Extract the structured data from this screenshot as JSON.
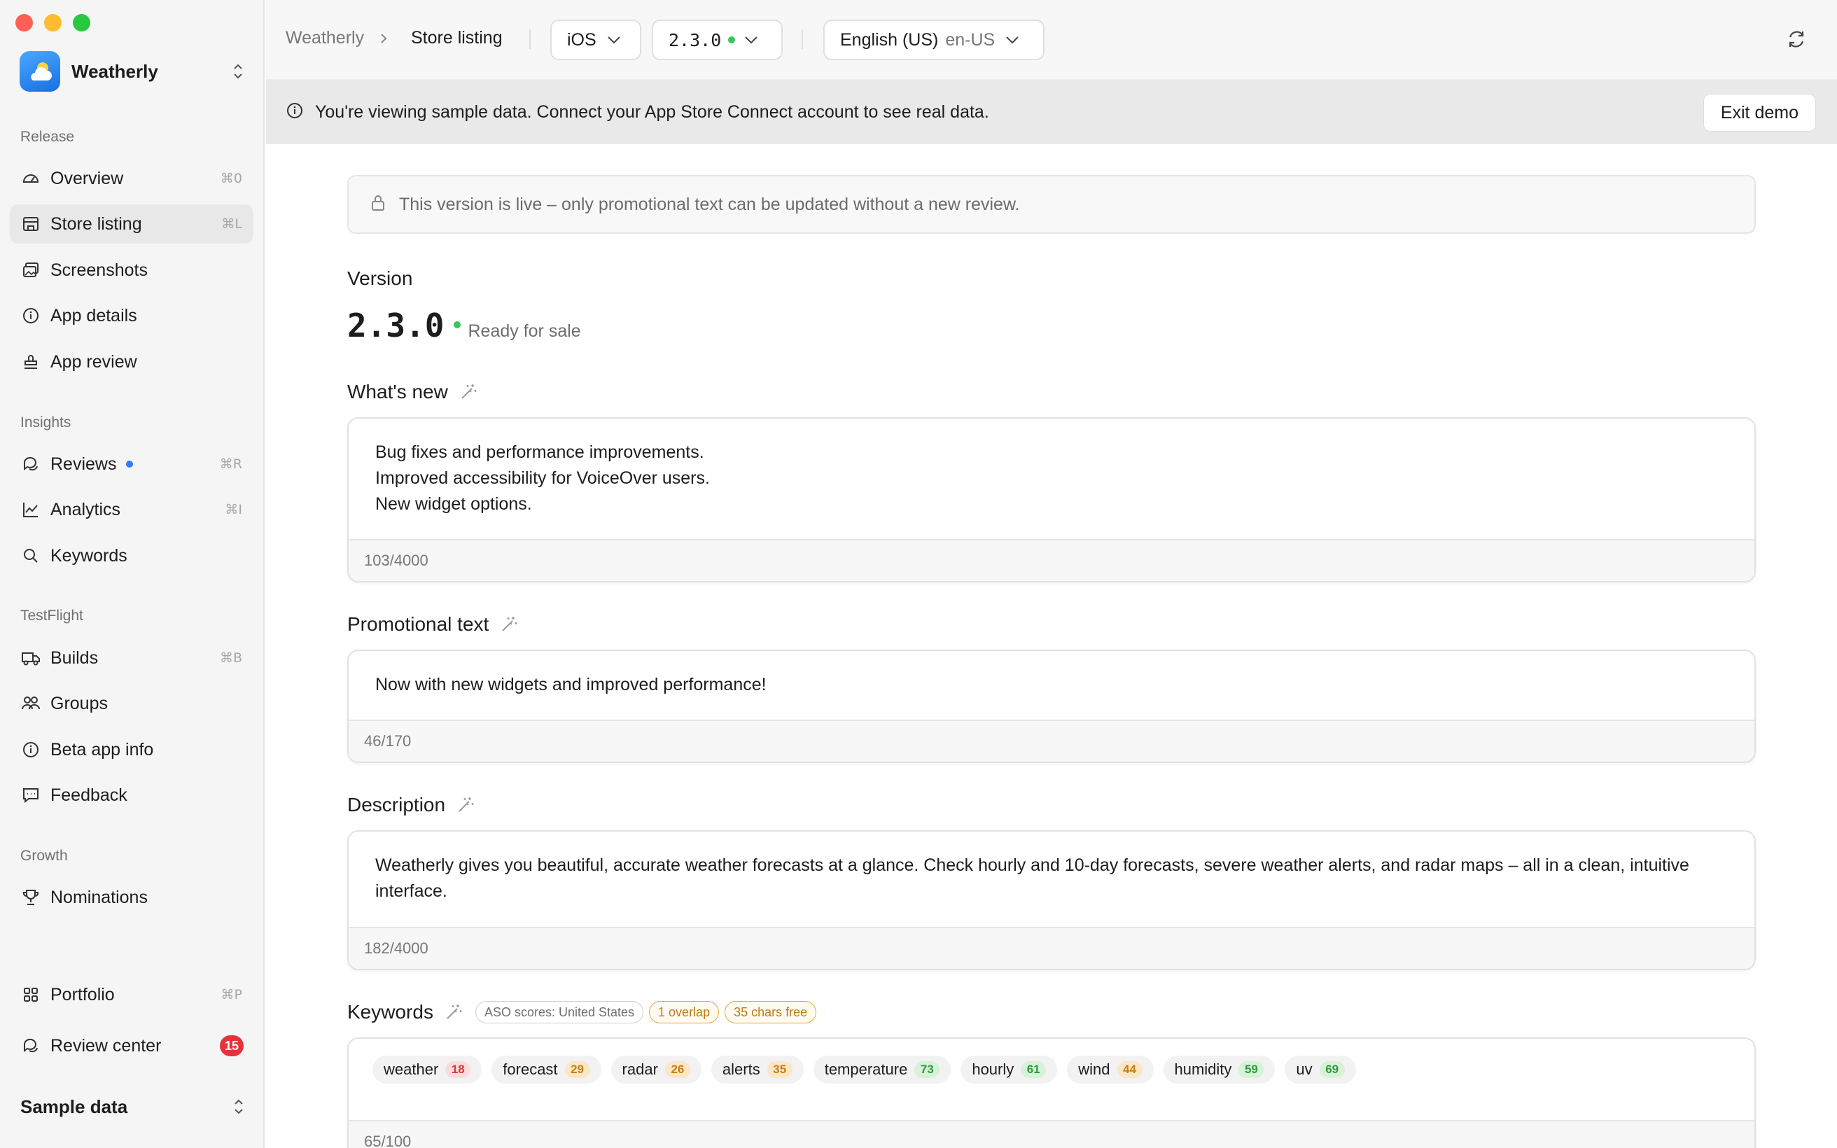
{
  "window": {
    "traffic_colors": [
      "#ff5f57",
      "#febc2e",
      "#28c840"
    ]
  },
  "app": {
    "name": "Weatherly"
  },
  "sidebar": {
    "sections": {
      "release": "Release",
      "insights": "Insights",
      "testflight": "TestFlight",
      "growth": "Growth"
    },
    "items": [
      {
        "label": "Overview",
        "shortcut": "⌘0",
        "icon": "gauge-icon"
      },
      {
        "label": "Store listing",
        "shortcut": "⌘L",
        "icon": "storefront-icon"
      },
      {
        "label": "Screenshots",
        "shortcut": "",
        "icon": "images-icon"
      },
      {
        "label": "App details",
        "shortcut": "",
        "icon": "info-icon"
      },
      {
        "label": "App review",
        "shortcut": "",
        "icon": "stamp-icon"
      },
      {
        "label": "Reviews",
        "shortcut": "⌘R",
        "icon": "chat-icon"
      },
      {
        "label": "Analytics",
        "shortcut": "⌘I",
        "icon": "chart-icon"
      },
      {
        "label": "Keywords",
        "shortcut": "",
        "icon": "search-icon"
      },
      {
        "label": "Builds",
        "shortcut": "⌘B",
        "icon": "truck-icon"
      },
      {
        "label": "Groups",
        "shortcut": "",
        "icon": "users-icon"
      },
      {
        "label": "Beta app info",
        "shortcut": "",
        "icon": "info-icon"
      },
      {
        "label": "Feedback",
        "shortcut": "",
        "icon": "message-icon"
      },
      {
        "label": "Nominations",
        "shortcut": "",
        "icon": "trophy-icon"
      },
      {
        "label": "Portfolio",
        "shortcut": "⌘P",
        "icon": "grid-icon"
      },
      {
        "label": "Review center",
        "badge": "15",
        "icon": "chat-icon"
      }
    ],
    "footer_label": "Sample data"
  },
  "topbar": {
    "breadcrumb_root": "Weatherly",
    "breadcrumb_current": "Store listing",
    "platform": "iOS",
    "version": "2.3.0",
    "locale_name": "English (US)",
    "locale_code": "en-US"
  },
  "banner": {
    "text": "You're viewing sample data. Connect your App Store Connect account to see real data.",
    "exit_label": "Exit demo"
  },
  "content": {
    "live_notice": "This version is live – only promotional text can be updated without a new review.",
    "version_heading": "Version",
    "version_number": "2.3.0",
    "version_status": "Ready for sale",
    "whats_new": {
      "heading": "What's new",
      "lines": [
        "Bug fixes and performance improvements.",
        "Improved accessibility for VoiceOver users.",
        "New widget options."
      ],
      "count": "103/4000"
    },
    "promo": {
      "heading": "Promotional text",
      "text": "Now with new widgets and improved performance!",
      "count": "46/170"
    },
    "description": {
      "heading": "Description",
      "text": "Weatherly gives you beautiful, accurate weather forecasts at a glance. Check hourly and 10-day forecasts, severe weather alerts, and radar maps – all in a clean, intuitive interface.",
      "count": "182/4000"
    },
    "keywords": {
      "heading": "Keywords",
      "aso_label": "ASO scores: United States",
      "overlap_label": "1 overlap",
      "free_label": "35 chars free",
      "items": [
        {
          "word": "weather",
          "score": "18",
          "level": "red"
        },
        {
          "word": "forecast",
          "score": "29",
          "level": "orange"
        },
        {
          "word": "radar",
          "score": "26",
          "level": "orange"
        },
        {
          "word": "alerts",
          "score": "35",
          "level": "orange"
        },
        {
          "word": "temperature",
          "score": "73",
          "level": "green"
        },
        {
          "word": "hourly",
          "score": "61",
          "level": "green"
        },
        {
          "word": "wind",
          "score": "44",
          "level": "orange"
        },
        {
          "word": "humidity",
          "score": "59",
          "level": "green"
        },
        {
          "word": "uv",
          "score": "69",
          "level": "green"
        }
      ],
      "count": "65/100"
    }
  }
}
